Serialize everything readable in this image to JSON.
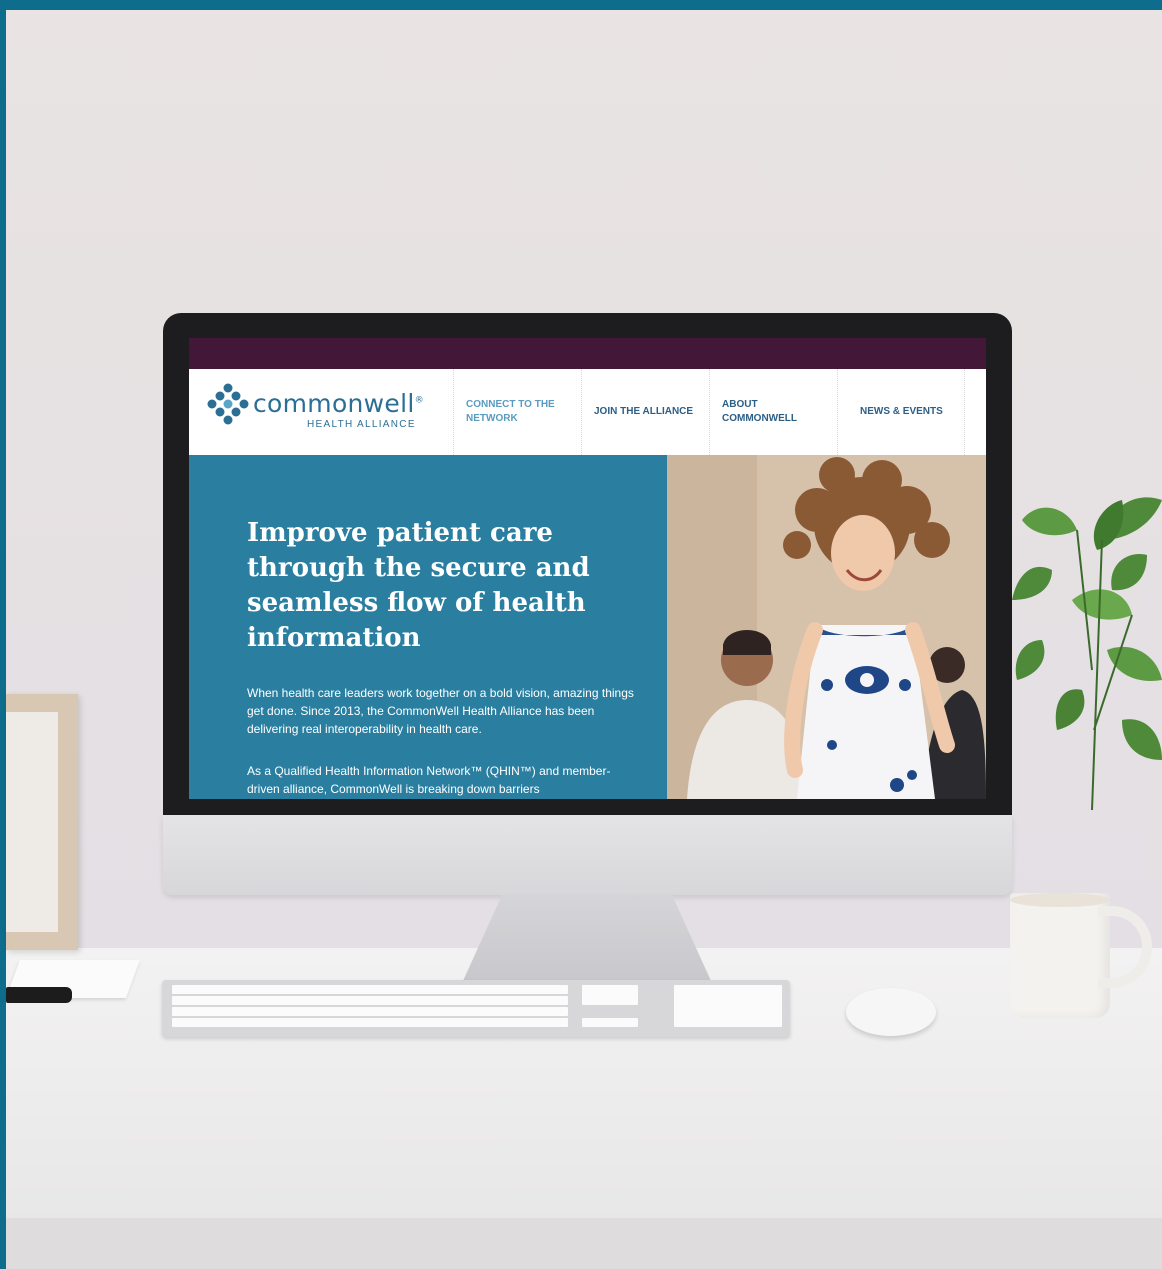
{
  "site": {
    "logo": {
      "word": "commonwell",
      "registered": "®",
      "subtitle": "HEALTH ALLIANCE"
    },
    "nav": [
      {
        "line1": "CONNECT TO THE",
        "line2": "NETWORK"
      },
      {
        "line1": "JOIN THE ALLIANCE",
        "line2": ""
      },
      {
        "line1": "ABOUT",
        "line2": "COMMONWELL"
      },
      {
        "line1": "NEWS & EVENTS",
        "line2": ""
      }
    ],
    "hero": {
      "title": "Improve patient care through the secure and seamless flow of health information",
      "paragraph1": "When health care leaders work together on a bold vision, amazing things get done. Since 2013, the CommonWell Health Alliance has been delivering real interoperability in health care.",
      "paragraph2": "As a Qualified Health Information Network™ (QHIN™) and member-driven alliance, CommonWell is breaking down barriers"
    }
  },
  "colors": {
    "frame": "#0e6d8c",
    "topbar": "#421738",
    "hero_bg": "#2a7fa1",
    "brand_blue": "#2c6f95",
    "nav_text": "#2b5f86",
    "nav_text_light": "#5a9bbf"
  },
  "icons": {
    "logo": "commonwell-logo-mark",
    "plant": "houseplant",
    "mug": "coffee-mug"
  }
}
